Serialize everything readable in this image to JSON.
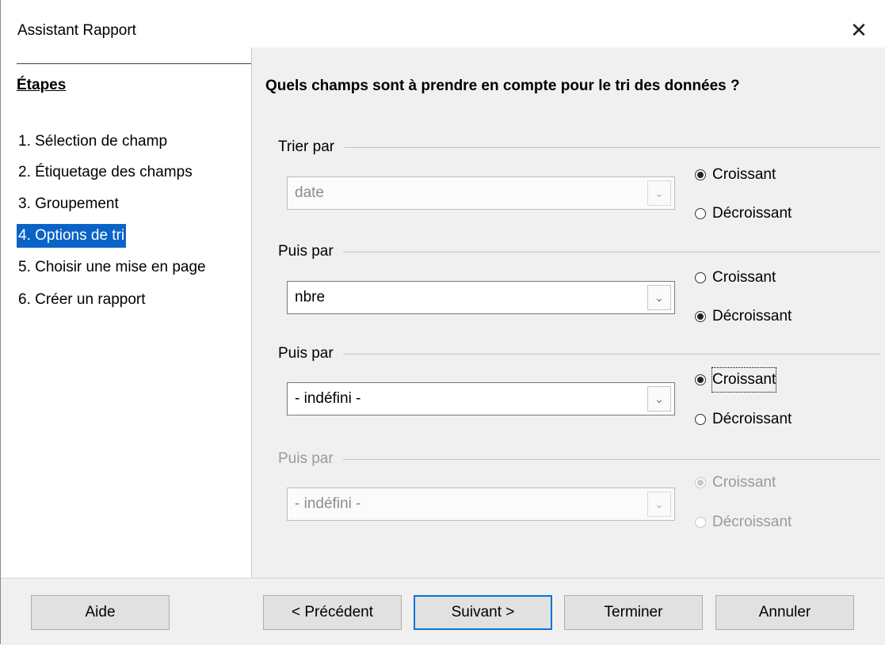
{
  "window": {
    "title": "Assistant Rapport",
    "close_glyph": "✕"
  },
  "sidebar": {
    "heading": "Étapes",
    "steps": [
      {
        "label": "1. Sélection de champ"
      },
      {
        "label": "2. Étiquetage des champs"
      },
      {
        "label": "3. Groupement"
      },
      {
        "label": "4. Options de tri",
        "selected": true
      },
      {
        "label": "5. Choisir une mise en page"
      },
      {
        "label": "6. Créer un rapport"
      }
    ]
  },
  "main": {
    "question": "Quels champs sont à prendre en compte pour le tri des données ?",
    "groups": [
      {
        "label": "Trier par",
        "value": "date",
        "enabled": false,
        "order": "Croissant",
        "asc": "Croissant",
        "desc": "Décroissant"
      },
      {
        "label": "Puis par",
        "value": "nbre",
        "enabled": true,
        "order": "Décroissant",
        "asc": "Croissant",
        "desc": "Décroissant"
      },
      {
        "label": "Puis par",
        "value": "- indéfini -",
        "enabled": true,
        "order": "Croissant",
        "asc": "Croissant",
        "desc": "Décroissant"
      },
      {
        "label": "Puis par",
        "value": "- indéfini -",
        "enabled": false,
        "order": "Croissant",
        "asc": "Croissant",
        "desc": "Décroissant"
      }
    ]
  },
  "footer": {
    "help": "Aide",
    "previous": "< Précédent",
    "next": "Suivant >",
    "finish": "Terminer",
    "cancel": "Annuler"
  },
  "icons": {
    "close": "close-icon",
    "dropdown": "chevron-down-icon"
  }
}
